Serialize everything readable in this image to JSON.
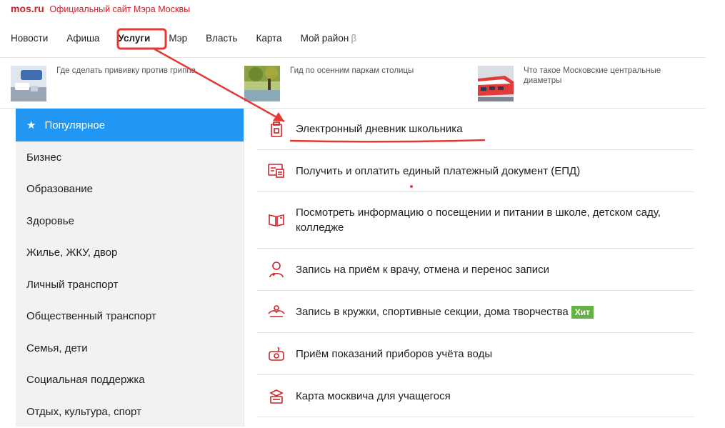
{
  "brand": {
    "logo": "mos.ru",
    "tagline": "Официальный сайт Мэра Москвы"
  },
  "nav": {
    "items": [
      "Новости",
      "Афиша",
      "Услуги",
      "Мэр",
      "Власть",
      "Карта",
      "Мой район"
    ],
    "active": "Услуги",
    "beta": "β"
  },
  "news": [
    {
      "text": "Где сделать прививку против гриппа"
    },
    {
      "text": "Гид по осенним паркам столицы"
    },
    {
      "text": "Что такое Московские центральные диаметры"
    }
  ],
  "sidebar": {
    "active": "Популярное",
    "items": [
      "Бизнес",
      "Образование",
      "Здоровье",
      "Жилье, ЖКУ, двор",
      "Личный транспорт",
      "Общественный транспорт",
      "Семья, дети",
      "Социальная поддержка",
      "Отдых, культура, спорт"
    ]
  },
  "services": [
    {
      "label": "Электронный дневник школьника",
      "icon": "diary-icon"
    },
    {
      "label": "Получить и оплатить единый платежный документ (ЕПД)",
      "icon": "payment-document-icon"
    },
    {
      "label": "Посмотреть информацию о посещении и питании в школе, детском саду, колледже",
      "icon": "book-icon"
    },
    {
      "label": "Запись на приём к врачу, отмена и перенос записи",
      "icon": "doctor-icon"
    },
    {
      "label": "Запись в кружки, спортивные секции, дома творчества",
      "icon": "clubs-icon",
      "badge": "Хит"
    },
    {
      "label": "Приём показаний приборов учёта воды",
      "icon": "water-meter-icon"
    },
    {
      "label": "Карта москвича для учащегося",
      "icon": "student-card-icon"
    }
  ],
  "colors": {
    "accent": "#cc2229",
    "active_blue": "#2196f3",
    "badge_green": "#64b146",
    "annotation_red": "#e53935"
  }
}
